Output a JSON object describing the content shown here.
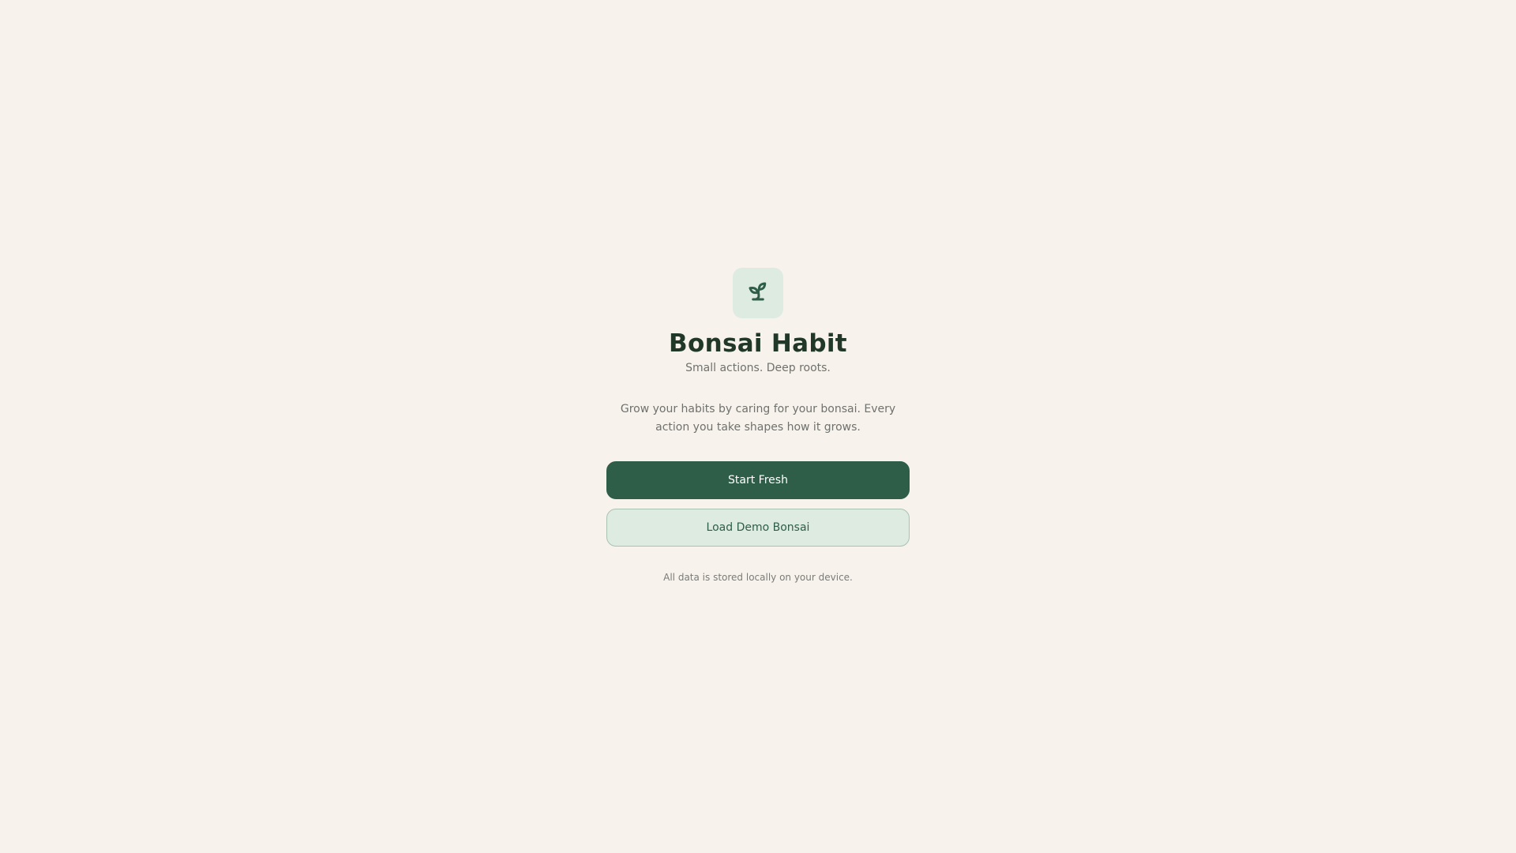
{
  "app": {
    "title": "Bonsai Habit",
    "tagline": "Small actions. Deep roots.",
    "logo_icon": "sprout-icon"
  },
  "intro": {
    "description": "Grow your habits by caring for your bonsai. Every action you take shapes how it grows."
  },
  "actions": {
    "start_label": "Start Fresh",
    "demo_label": "Load Demo Bonsai"
  },
  "footer": {
    "note": "All data is stored locally on your device."
  },
  "colors": {
    "background": "#f7f2ec",
    "primary": "#2e5e48",
    "primary_light": "#ddebe1",
    "heading": "#213829",
    "muted_text": "#6f716d"
  }
}
